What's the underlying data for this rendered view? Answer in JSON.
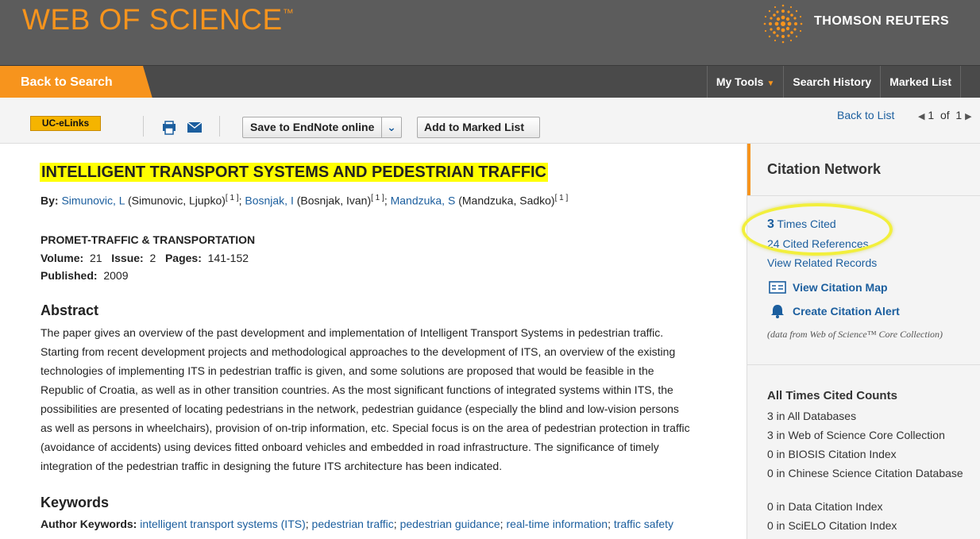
{
  "header": {
    "logo_text": "WEB OF SCIENCE",
    "logo_tm": "™",
    "brand_text": "THOMSON REUTERS",
    "brand_icon": "thomson-reuters-dot-logo"
  },
  "nav": {
    "back_to_search": "Back to Search",
    "my_tools": "My Tools",
    "search_history": "Search History",
    "marked_list": "Marked List"
  },
  "toolbar": {
    "uc_elinks": "UC-eLinks",
    "save_endnote": "Save to EndNote online",
    "add_marked": "Add to Marked List",
    "back_to_list": "Back to List",
    "page_current": "1",
    "page_of": "of",
    "page_total": "1"
  },
  "record": {
    "title": "INTELLIGENT TRANSPORT SYSTEMS AND PEDESTRIAN TRAFFIC",
    "by_label": "By:",
    "authors": [
      {
        "short": "Simunovic, L",
        "full": "(Simunovic, Ljupko)",
        "aff": "[ 1 ]"
      },
      {
        "short": "Bosnjak, I",
        "full": "(Bosnjak, Ivan)",
        "aff": "[ 1 ]"
      },
      {
        "short": "Mandzuka, S",
        "full": "(Mandzuka, Sadko)",
        "aff": "[ 1 ]"
      }
    ],
    "journal": "PROMET-TRAFFIC & TRANSPORTATION",
    "volume_label": "Volume:",
    "volume": "21",
    "issue_label": "Issue:",
    "issue": "2",
    "pages_label": "Pages:",
    "pages": "141-152",
    "published_label": "Published:",
    "published": "2009",
    "abstract_heading": "Abstract",
    "abstract_lines": [
      "The paper gives an overview of the past development and implementation of Intelligent Transport Systems in pedestrian traffic.",
      "Starting from recent development projects and methodological approaches to the development of ITS, an overview of the existing",
      "technologies of implementing ITS in pedestrian traffic is given, and some solutions are proposed that would be feasible in the",
      "Republic of Croatia, as well as in other transition countries. As the most significant functions of integrated systems within ITS, the",
      "possibilities are presented of locating pedestrians in the network, pedestrian guidance (especially the blind and low-vision persons",
      "as well as persons in wheelchairs), provision of on-trip information, etc. Special focus is on the area of pedestrian protection in traffic",
      "(avoidance of accidents) using devices fitted onboard vehicles and embedded in road infrastructure. The significance of timely",
      "integration of the pedestrian traffic in designing the future ITS architecture has been indicated."
    ],
    "keywords_heading": "Keywords",
    "author_keywords_label": "Author Keywords:",
    "keywords": [
      "intelligent transport systems (ITS)",
      "pedestrian traffic",
      "pedestrian guidance",
      "real-time information",
      "traffic safety"
    ]
  },
  "sidebar": {
    "title": "Citation Network",
    "times_cited_count": "3",
    "times_cited_label": "Times Cited",
    "cited_references": "24 Cited References",
    "related_records": "View Related Records",
    "citation_map": "View Citation Map",
    "citation_alert": "Create Citation Alert",
    "data_note": "(data from Web of Science™ Core Collection)",
    "counts_heading": "All Times Cited Counts",
    "count_items": [
      {
        "text": "3 in All Databases",
        "link": true
      },
      {
        "text": "3 in Web of Science Core Collection",
        "link": true
      },
      {
        "text": "0 in BIOSIS Citation Index",
        "link": false
      },
      {
        "text": "0 in Chinese Science Citation Database",
        "link": false
      },
      {
        "text": "0 in Data Citation Index",
        "link": false
      },
      {
        "text": "0 in SciELO Citation Index",
        "link": false
      }
    ]
  },
  "colors": {
    "accent_orange": "#f7941d",
    "link_blue": "#1b5e9e",
    "title_highlight": "#ffff00",
    "header_gray": "#5c5c5c"
  }
}
